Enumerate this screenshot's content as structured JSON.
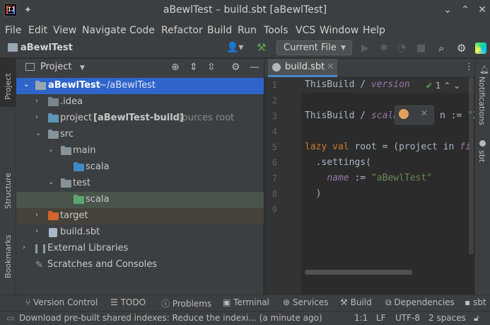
{
  "window": {
    "title": "aBewlTest – build.sbt [aBewlTest]"
  },
  "menu": [
    "File",
    "Edit",
    "View",
    "Navigate",
    "Code",
    "Refactor",
    "Build",
    "Run",
    "Tools",
    "VCS",
    "Window",
    "Help"
  ],
  "nav": {
    "project_name": "aBewlTest",
    "run_config": "Current File"
  },
  "left_stripe": {
    "project": "Project",
    "structure": "Structure",
    "bookmarks": "Bookmarks"
  },
  "right_stripe": {
    "notifications": "Notifications",
    "sbt": "sbt"
  },
  "project_panel": {
    "title": "Project",
    "tree": [
      {
        "name": "aBewlTest",
        "extra": "~/aBewlTest"
      },
      {
        "name": ".idea"
      },
      {
        "name": "project",
        "bold": "[aBewlTest-build]",
        "extra": "sources root"
      },
      {
        "name": "src"
      },
      {
        "name": "main"
      },
      {
        "name": "scala"
      },
      {
        "name": "test"
      },
      {
        "name": "scala"
      },
      {
        "name": "target"
      },
      {
        "name": "build.sbt"
      },
      {
        "name": "External Libraries"
      },
      {
        "name": "Scratches and Consoles"
      }
    ]
  },
  "editor": {
    "tab": "build.sbt",
    "inspection_count": "1",
    "line_numbers": [
      "1",
      "2",
      "3",
      "4",
      "5",
      "6",
      "7",
      "8",
      "9"
    ],
    "code": {
      "l1_obj": "ThisBuild",
      "l1_sep": " / ",
      "l1_key": "version",
      "l3_obj": "ThisBuild",
      "l3_sep": " / ",
      "l3_key": "scala",
      "l3_tail": "n := \"2",
      "l5_kw": "lazy val",
      "l5_rest": " root = (project in ",
      "l5_tail": "fi",
      "l6": "  .settings(",
      "l7_key": "name",
      "l7_op": " := ",
      "l7_str": "\"aBewlTest\"",
      "l8": "  )"
    }
  },
  "bottom_tools": [
    "Version Control",
    "TODO",
    "Problems",
    "Terminal",
    "Services",
    "Build",
    "Dependencies",
    "sbt"
  ],
  "status": {
    "message": "Download pre-built shared indexes: Reduce the indexi... (a minute ago)",
    "position": "1:1",
    "line_sep": "LF",
    "encoding": "UTF-8",
    "indent": "2 spaces"
  },
  "colors": {
    "selection": "#2f65ca",
    "accent_tab": "#4a88c7"
  }
}
